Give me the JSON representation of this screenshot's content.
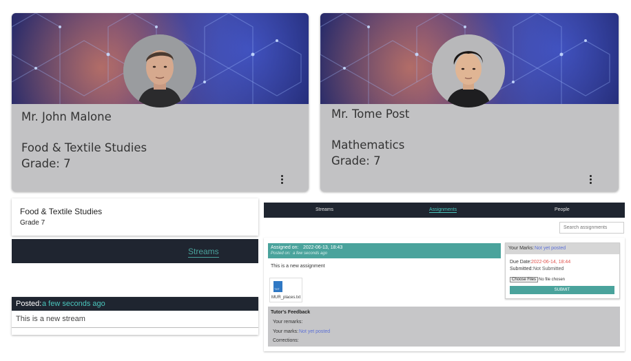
{
  "teachers": [
    {
      "name": "Mr. John Malone",
      "subject": "Food & Textile Studies",
      "grade": "Grade: 7"
    },
    {
      "name": "Mr. Tome Post",
      "subject": "Mathematics",
      "grade": "Grade: 7"
    }
  ],
  "class_header": {
    "title": "Food & Textile Studies",
    "grade": "Grade 7"
  },
  "left_nav": {
    "active_tab": "Streams"
  },
  "stream_post": {
    "posted_label": "Posted:",
    "posted_time": "a few seconds ago",
    "body": "This is a new stream"
  },
  "tabs": [
    "Streams",
    "Assignments",
    "People"
  ],
  "search": {
    "placeholder": "Search assignments"
  },
  "assignment": {
    "assigned_label": "Assigned on:",
    "assigned_date": "2022-06-13, 18:43",
    "posted_label": "Posted on:",
    "posted_time": "a few seconds ago",
    "body": "This is a new assignment",
    "file_icon_text": "TXT",
    "file_name": "MUR_places.txt"
  },
  "marks": {
    "title_label": "Your Marks:",
    "title_value": "Not yet posted",
    "due_label": "Due Date:",
    "due_value": "2022-06-14, 18:44",
    "submitted_label": "Submitted:",
    "submitted_value": "Not Submitted",
    "choose_files_label": "Choose Files",
    "no_file_text": "No file chosen",
    "submit_label": "SUBMIT"
  },
  "feedback": {
    "title": "Tutor's Feedback",
    "remarks_label": "Your remarks:",
    "marks_label": "Your marks:",
    "marks_value": "Not yet posted",
    "corrections_label": "Corrections:"
  },
  "colors": {
    "teal": "#4aa39c",
    "dark": "#1f2530",
    "card_grey": "#c2c2c4",
    "red": "#e0524d",
    "blue": "#5b6fd6"
  }
}
